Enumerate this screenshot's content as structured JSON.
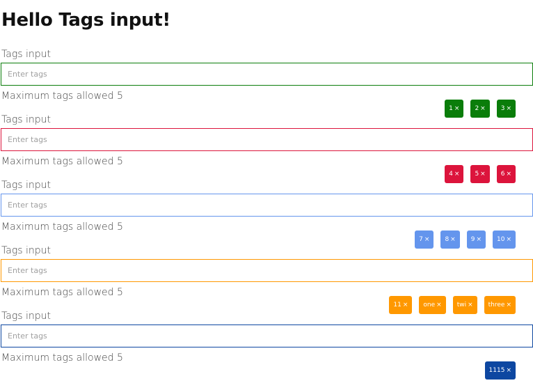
{
  "page": {
    "title": "Hello Tags input!"
  },
  "groups": [
    {
      "label": "Tags input",
      "placeholder": "Enter tags",
      "max_text": "Maximum tags allowed 5",
      "color": "#0a7d0a",
      "tags": [
        "1",
        "2",
        "3"
      ]
    },
    {
      "label": "Tags input",
      "placeholder": "Enter tags",
      "max_text": "Maximum tags allowed 5",
      "color": "#dc143c",
      "tags": [
        "4",
        "5",
        "6"
      ]
    },
    {
      "label": "Tags input",
      "placeholder": "Enter tags",
      "max_text": "Maximum tags allowed 5",
      "color": "#6495ed",
      "tags": [
        "7",
        "8",
        "9",
        "10"
      ]
    },
    {
      "label": "Tags input",
      "placeholder": "Enter tags",
      "max_text": "Maximum tags allowed 5",
      "color": "#ff9800",
      "tags": [
        "11",
        "one",
        "twi",
        "three"
      ]
    },
    {
      "label": "Tags input",
      "placeholder": "Enter tags",
      "max_text": "Maximum tags allowed 5",
      "color": "#0d47a1",
      "tags": [
        "1115"
      ]
    }
  ],
  "remove_glyph": "×"
}
